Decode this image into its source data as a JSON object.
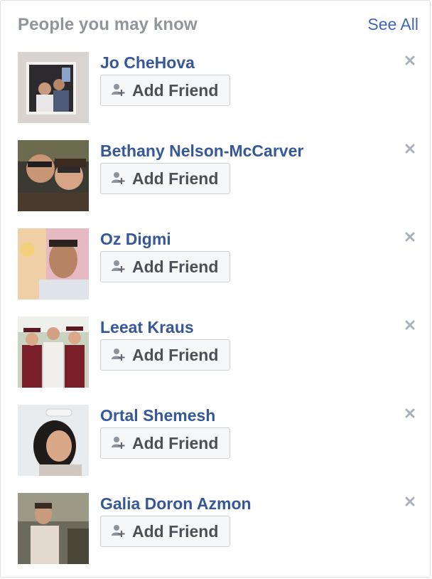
{
  "header": {
    "title": "People you may know",
    "see_all_label": "See All"
  },
  "colors": {
    "link": "#365899",
    "accent": "#4267b2",
    "muted": "#90949c"
  },
  "icons": {
    "add": "add-friend-icon",
    "close": "close-icon"
  },
  "people": [
    {
      "name": "Jo CheHova",
      "button_label": "Add Friend"
    },
    {
      "name": "Bethany Nelson-McCarver",
      "button_label": "Add Friend"
    },
    {
      "name": "Oz Digmi",
      "button_label": "Add Friend"
    },
    {
      "name": "Leeat Kraus",
      "button_label": "Add Friend"
    },
    {
      "name": "Ortal Shemesh",
      "button_label": "Add Friend"
    },
    {
      "name": "Galia Doron Azmon",
      "button_label": "Add Friend"
    }
  ]
}
